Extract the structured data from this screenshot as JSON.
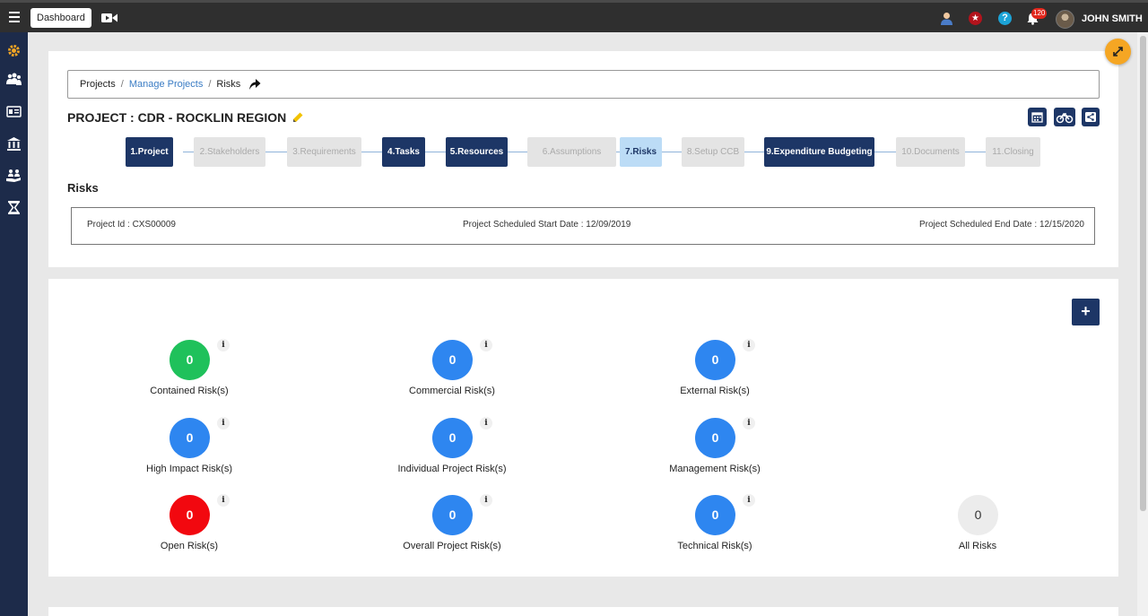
{
  "topbar": {
    "dashboard_label": "Dashboard",
    "notification_count": "120",
    "user_name": "JOHN SMITH",
    "star_glyph": "★",
    "help_glyph": "?"
  },
  "breadcrumb": {
    "items": [
      "Projects",
      "Manage Projects",
      "Risks"
    ],
    "separator": "/"
  },
  "project": {
    "title": "PROJECT : CDR - ROCKLIN REGION"
  },
  "steps": [
    {
      "label": "1.Project",
      "state": "done"
    },
    {
      "label": "2.Stakeholders",
      "state": "todo"
    },
    {
      "label": "3.Requirements",
      "state": "todo"
    },
    {
      "label": "4.Tasks",
      "state": "done"
    },
    {
      "label": "5.Resources",
      "state": "done"
    },
    {
      "label": "6.Assumptions",
      "state": "todo"
    },
    {
      "label": "7.Risks",
      "state": "active"
    },
    {
      "label": "8.Setup CCB",
      "state": "todo"
    },
    {
      "label": "9.Expenditure Budgeting",
      "state": "done"
    },
    {
      "label": "10.Documents",
      "state": "todo"
    },
    {
      "label": "11.Closing",
      "state": "todo"
    }
  ],
  "risks_section": {
    "heading": "Risks",
    "project_id": "Project Id : CXS00009",
    "start_date": "Project Scheduled Start Date : 12/09/2019",
    "end_date": "Project Scheduled End Date : 12/15/2020",
    "add_label": "+"
  },
  "metrics": [
    {
      "label": "Contained Risk(s)",
      "value": "0",
      "color": "#1fc15b"
    },
    {
      "label": "Commercial Risk(s)",
      "value": "0",
      "color": "#2e86f0"
    },
    {
      "label": "External Risk(s)",
      "value": "0",
      "color": "#2e86f0"
    },
    {
      "label": "High Impact Risk(s)",
      "value": "0",
      "color": "#2e86f0"
    },
    {
      "label": "Individual Project Risk(s)",
      "value": "0",
      "color": "#2e86f0"
    },
    {
      "label": "Management Risk(s)",
      "value": "0",
      "color": "#2e86f0"
    },
    {
      "label": "Open Risk(s)",
      "value": "0",
      "color": "#f2080f"
    },
    {
      "label": "Overall Project Risk(s)",
      "value": "0",
      "color": "#2e86f0"
    },
    {
      "label": "Technical Risk(s)",
      "value": "0",
      "color": "#2e86f0"
    },
    {
      "label": "All Risks",
      "value": "0",
      "color": "#ececec"
    }
  ],
  "info_glyph": "i"
}
